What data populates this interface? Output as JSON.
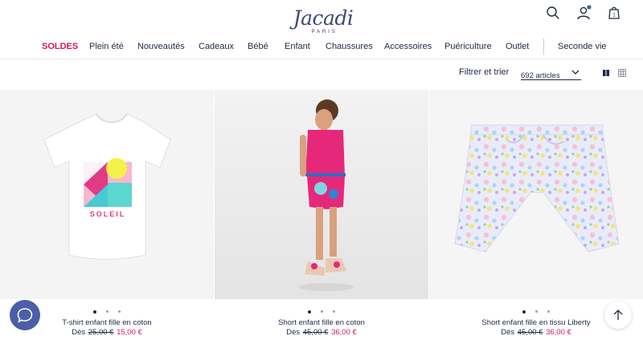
{
  "brand": {
    "name": "Jacadi",
    "sub": "PARIS"
  },
  "header": {
    "icons": [
      "search-icon",
      "account-icon",
      "cart-icon"
    ],
    "cart_count": "1"
  },
  "nav": {
    "items": [
      {
        "label": "SOLDES",
        "sale": true
      },
      {
        "label": "Plein été"
      },
      {
        "label": "Nouveautés"
      },
      {
        "label": "Cadeaux"
      },
      {
        "label": "Bébé"
      },
      {
        "label": "Enfant"
      },
      {
        "label": "Chaussures"
      },
      {
        "label": "Accessoires"
      },
      {
        "label": "Puériculture"
      },
      {
        "label": "Outlet"
      },
      {
        "label": "Seconde vie"
      }
    ]
  },
  "filters": {
    "filter_label": "Filtrer et trier",
    "count_label": "692 articles",
    "view_modes": [
      "list-view-icon",
      "grid-view-icon"
    ]
  },
  "products": [
    {
      "name": "T-shirt enfant fille en coton",
      "price_prefix": "Dès",
      "old_price": "25,00 €",
      "new_price": "15,00 €",
      "tshirt_text": "SOLEIL"
    },
    {
      "name": "Short enfant fille en coton",
      "price_prefix": "Dès",
      "old_price": "45,00 €",
      "new_price": "36,00 €"
    },
    {
      "name": "Short enfant fille en tissu Liberty",
      "price_prefix": "Dès",
      "old_price": "45,00 €",
      "new_price": "36,00 €"
    }
  ],
  "colors": {
    "navy": "#1f2a44",
    "sale": "#d6175f",
    "chat": "#4a5fa8",
    "logo": "#3d4a78"
  }
}
